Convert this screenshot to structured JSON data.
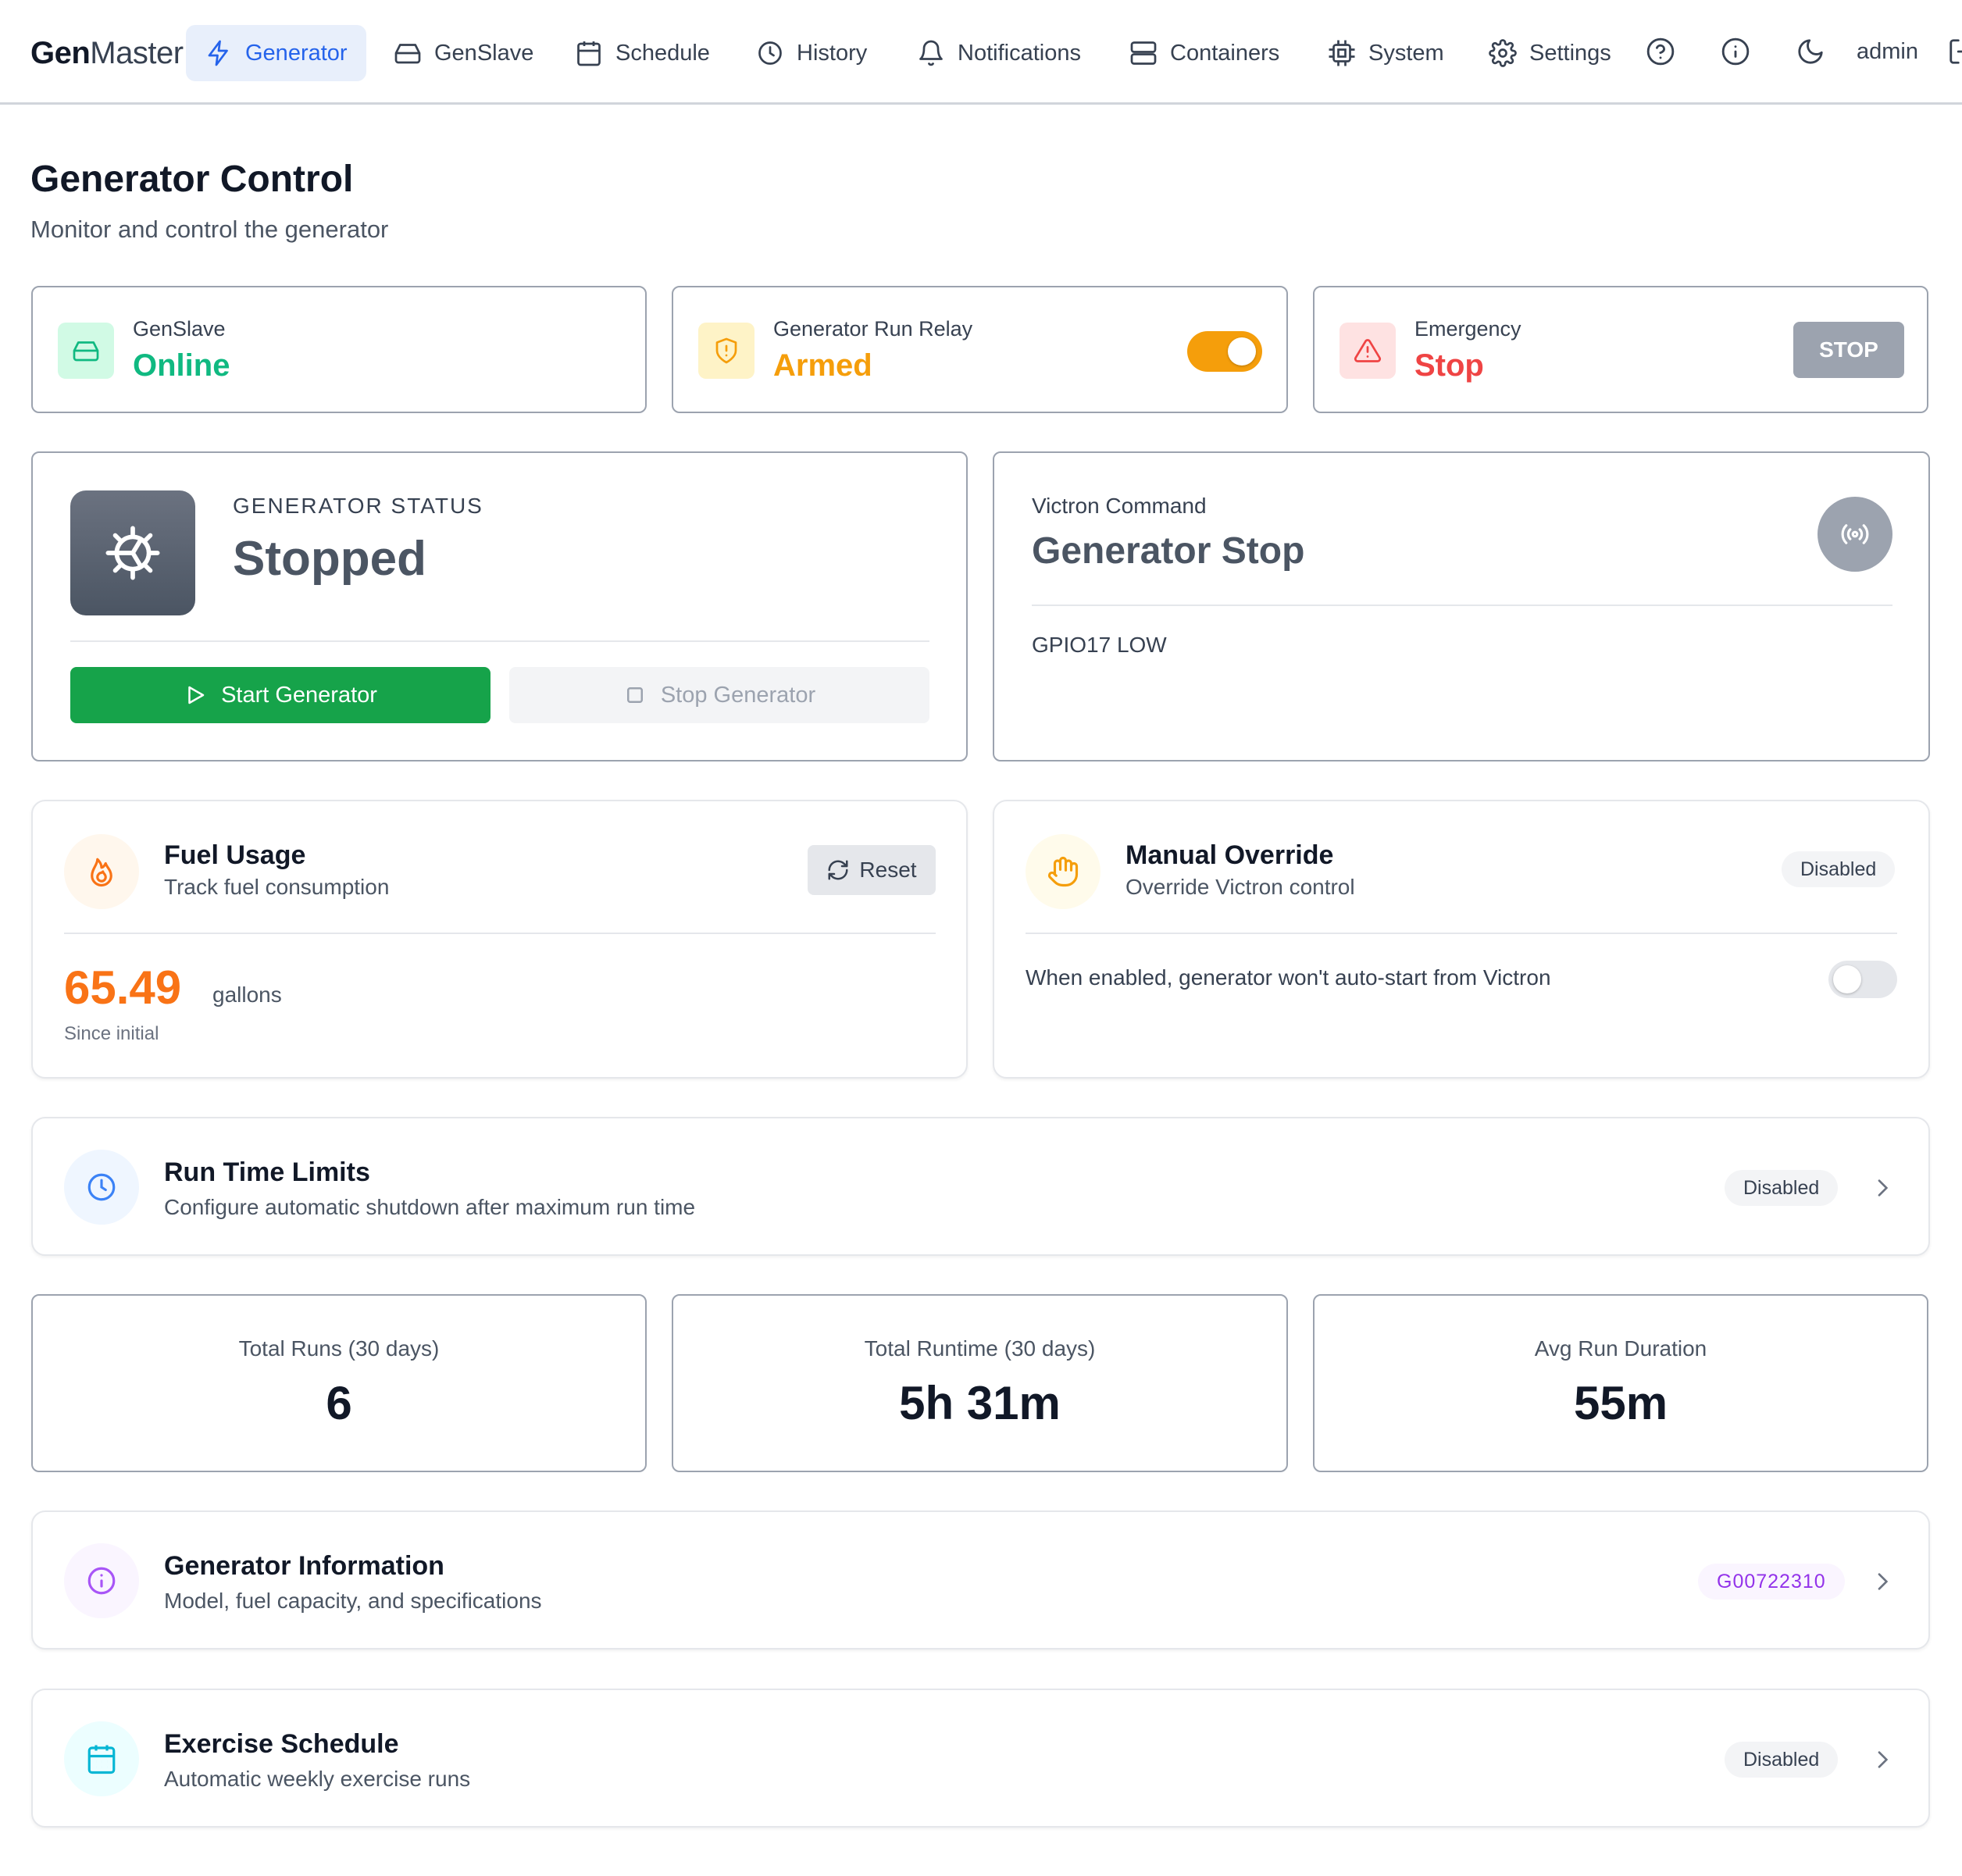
{
  "app": {
    "logo_bold": "Gen",
    "logo_light": "Master"
  },
  "nav": {
    "items": [
      {
        "label": "Generator",
        "icon": "bolt-icon"
      },
      {
        "label": "GenSlave",
        "icon": "hard-drive-icon"
      },
      {
        "label": "Schedule",
        "icon": "calendar-icon"
      },
      {
        "label": "History",
        "icon": "clock-icon"
      },
      {
        "label": "Notifications",
        "icon": "bell-icon"
      },
      {
        "label": "Containers",
        "icon": "server-icon"
      },
      {
        "label": "System",
        "icon": "cpu-icon"
      },
      {
        "label": "Settings",
        "icon": "gear-icon"
      }
    ],
    "user": "admin"
  },
  "header": {
    "title": "Generator Control",
    "subtitle": "Monitor and control the generator"
  },
  "status_cards": {
    "genslave": {
      "label": "GenSlave",
      "value": "Online",
      "color": "#10b981"
    },
    "relay": {
      "label": "Generator Run Relay",
      "value": "Armed",
      "color": "#f59e0b",
      "toggle_on": true
    },
    "emergency": {
      "label": "Emergency",
      "value": "Stop",
      "color": "#ef4444",
      "button": "STOP"
    }
  },
  "generator_status": {
    "label": "GENERATOR STATUS",
    "value": "Stopped",
    "start_button": "Start Generator",
    "stop_button": "Stop Generator"
  },
  "victron": {
    "label": "Victron Command",
    "value": "Generator Stop",
    "gpio": "GPIO17 LOW"
  },
  "fuel": {
    "title": "Fuel Usage",
    "subtitle": "Track fuel consumption",
    "reset_button": "Reset",
    "value": "65.49",
    "unit": "gallons",
    "note": "Since initial"
  },
  "override": {
    "title": "Manual Override",
    "subtitle": "Override Victron control",
    "badge": "Disabled",
    "description": "When enabled, generator won't auto-start from Victron",
    "toggle_on": false
  },
  "run_time_limits": {
    "title": "Run Time Limits",
    "subtitle": "Configure automatic shutdown after maximum run time",
    "badge": "Disabled"
  },
  "metrics": [
    {
      "label": "Total Runs (30 days)",
      "value": "6"
    },
    {
      "label": "Total Runtime (30 days)",
      "value": "5h 31m"
    },
    {
      "label": "Avg Run Duration",
      "value": "55m"
    }
  ],
  "generator_info": {
    "title": "Generator Information",
    "subtitle": "Model, fuel capacity, and specifications",
    "badge": "G00722310"
  },
  "exercise": {
    "title": "Exercise Schedule",
    "subtitle": "Automatic weekly exercise runs",
    "badge": "Disabled"
  }
}
